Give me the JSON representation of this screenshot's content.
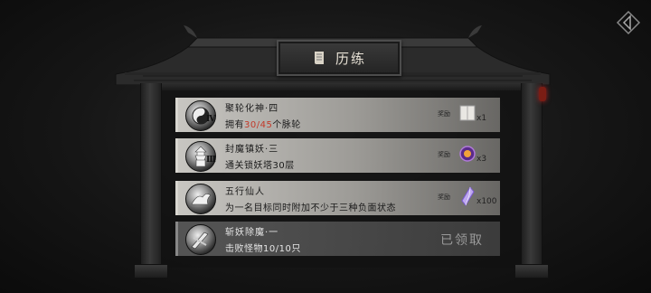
{
  "header": {
    "title": "历练"
  },
  "tasks": [
    {
      "name": "聚轮化神·四",
      "tier": "Ⅳ",
      "desc_prefix": "拥有",
      "progress_current": "30",
      "progress_sep": "/",
      "progress_total": "45",
      "desc_suffix": "个脉轮",
      "reward_label": "奖励",
      "reward_icon": "scroll-book-icon",
      "reward_count": "x1"
    },
    {
      "name": "封魔镇妖·三",
      "tier": "Ⅲ",
      "desc": "通关锁妖塔30层",
      "reward_label": "奖励",
      "reward_icon": "purple-orb-icon",
      "reward_count": "x3"
    },
    {
      "name": "五行仙人",
      "desc": "为一名目标同时附加不少于三种负面状态",
      "reward_label": "奖励",
      "reward_icon": "crystal-shard-icon",
      "reward_count": "x100"
    },
    {
      "name": "斩妖除魔·一",
      "desc": "击败怪物10/10只",
      "status": "已领取"
    }
  ],
  "colors": {
    "highlight": "#c23a2a",
    "row_bg": "#d7d5d0",
    "claimed_bg": "#5c5c5c"
  }
}
